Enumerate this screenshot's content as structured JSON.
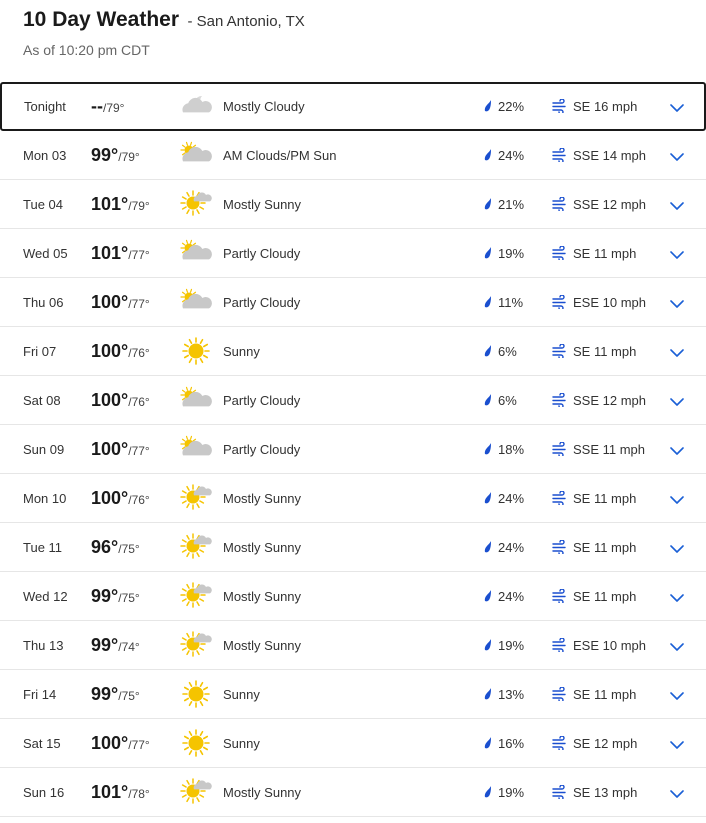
{
  "header": {
    "title": "10 Day Weather",
    "location": "- San Antonio, TX",
    "as_of": "As of 10:20 pm CDT"
  },
  "colors": {
    "accent": "#1a5fd6",
    "precip_icon": "#1a4fcf",
    "sun": "#f5c400",
    "cloud": "#c8c8c8"
  },
  "days": [
    {
      "day": "Tonight",
      "hi": "--",
      "lo": "/79°",
      "icon": "mostly-cloudy-night-icon",
      "cond": "Mostly Cloudy",
      "precip": "22%",
      "wind": "SE 16 mph"
    },
    {
      "day": "Mon 03",
      "hi": "99°",
      "lo": "/79°",
      "icon": "partly-cloudy-icon",
      "cond": "AM Clouds/PM Sun",
      "precip": "24%",
      "wind": "SSE 14 mph"
    },
    {
      "day": "Tue 04",
      "hi": "101°",
      "lo": "/79°",
      "icon": "mostly-sunny-icon",
      "cond": "Mostly Sunny",
      "precip": "21%",
      "wind": "SSE 12 mph"
    },
    {
      "day": "Wed 05",
      "hi": "101°",
      "lo": "/77°",
      "icon": "partly-cloudy-icon",
      "cond": "Partly Cloudy",
      "precip": "19%",
      "wind": "SE 11 mph"
    },
    {
      "day": "Thu 06",
      "hi": "100°",
      "lo": "/77°",
      "icon": "partly-cloudy-icon",
      "cond": "Partly Cloudy",
      "precip": "11%",
      "wind": "ESE 10 mph"
    },
    {
      "day": "Fri 07",
      "hi": "100°",
      "lo": "/76°",
      "icon": "sunny-icon",
      "cond": "Sunny",
      "precip": "6%",
      "wind": "SE 11 mph"
    },
    {
      "day": "Sat 08",
      "hi": "100°",
      "lo": "/76°",
      "icon": "partly-cloudy-icon",
      "cond": "Partly Cloudy",
      "precip": "6%",
      "wind": "SSE 12 mph"
    },
    {
      "day": "Sun 09",
      "hi": "100°",
      "lo": "/77°",
      "icon": "partly-cloudy-icon",
      "cond": "Partly Cloudy",
      "precip": "18%",
      "wind": "SSE 11 mph"
    },
    {
      "day": "Mon 10",
      "hi": "100°",
      "lo": "/76°",
      "icon": "mostly-sunny-icon",
      "cond": "Mostly Sunny",
      "precip": "24%",
      "wind": "SE 11 mph"
    },
    {
      "day": "Tue 11",
      "hi": "96°",
      "lo": "/75°",
      "icon": "mostly-sunny-icon",
      "cond": "Mostly Sunny",
      "precip": "24%",
      "wind": "SE 11 mph"
    },
    {
      "day": "Wed 12",
      "hi": "99°",
      "lo": "/75°",
      "icon": "mostly-sunny-icon",
      "cond": "Mostly Sunny",
      "precip": "24%",
      "wind": "SE 11 mph"
    },
    {
      "day": "Thu 13",
      "hi": "99°",
      "lo": "/74°",
      "icon": "mostly-sunny-icon",
      "cond": "Mostly Sunny",
      "precip": "19%",
      "wind": "ESE 10 mph"
    },
    {
      "day": "Fri 14",
      "hi": "99°",
      "lo": "/75°",
      "icon": "sunny-icon",
      "cond": "Sunny",
      "precip": "13%",
      "wind": "SE 11 mph"
    },
    {
      "day": "Sat 15",
      "hi": "100°",
      "lo": "/77°",
      "icon": "sunny-icon",
      "cond": "Sunny",
      "precip": "16%",
      "wind": "SE 12 mph"
    },
    {
      "day": "Sun 16",
      "hi": "101°",
      "lo": "/78°",
      "icon": "mostly-sunny-icon",
      "cond": "Mostly Sunny",
      "precip": "19%",
      "wind": "SE 13 mph"
    }
  ]
}
